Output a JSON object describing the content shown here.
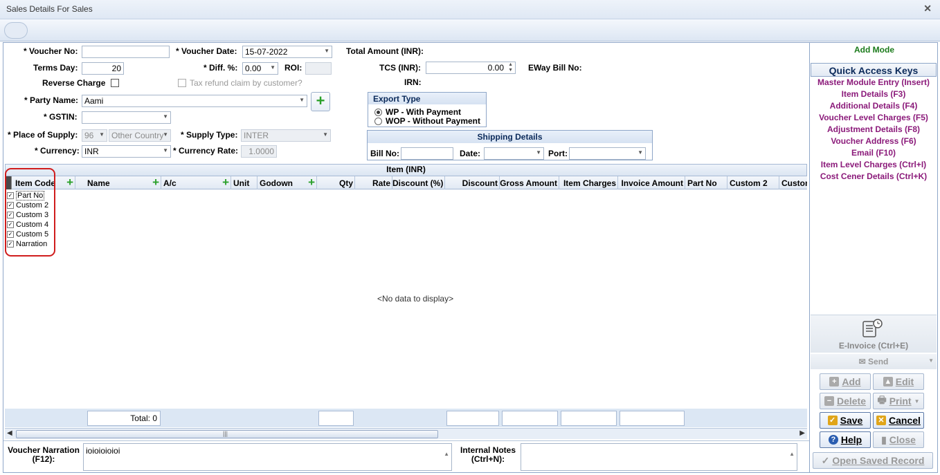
{
  "window": {
    "title": "Sales Details For Sales"
  },
  "form": {
    "voucher_no_label": "* Voucher No:",
    "voucher_no_value": "",
    "voucher_date_label": "* Voucher Date:",
    "voucher_date_value": "15-07-2022",
    "total_amount_label": "Total Amount (INR):",
    "terms_day_label": "Terms Day:",
    "terms_day_value": "20",
    "diff_label": "* Diff. %:",
    "diff_value": "0.00",
    "roi_label": "ROI:",
    "tcs_label": "TCS (INR):",
    "tcs_value": "0.00",
    "eway_label": "EWay Bill No:",
    "reverse_charge_label": "Reverse Charge",
    "tax_refund_label": "Tax refund claim by customer?",
    "irn_label": "IRN:",
    "party_name_label": "* Party Name:",
    "party_name_value": "Aami",
    "gstin_label": "* GSTIN:",
    "gstin_value": "",
    "place_label": "* Place of Supply:",
    "place_code": "96",
    "place_name": "Other Country",
    "supply_type_label": "* Supply Type:",
    "supply_type_value": "INTER",
    "currency_label": "* Currency:",
    "currency_value": "INR",
    "currency_rate_label": "* Currency Rate:",
    "currency_rate_value": "1.0000"
  },
  "export_type": {
    "title": "Export Type",
    "options": [
      {
        "label": "WP - With Payment",
        "selected": true
      },
      {
        "label": "WOP - Without Payment",
        "selected": false
      }
    ]
  },
  "shipping": {
    "title": "Shipping Details",
    "bill_no_label": "Bill No:",
    "date_label": "Date:",
    "port_label": "Port:"
  },
  "grid": {
    "band_title": "Item (INR)",
    "columns": [
      "Item Code",
      "Name",
      "A/c",
      "Unit",
      "Godown",
      "Qty",
      "Rate",
      "Discount (%)",
      "Discount",
      "Gross Amount",
      "Item Charges",
      "Invoice Amount",
      "Part No",
      "Custom 2",
      "Custom"
    ],
    "chooser_items": [
      "Part No",
      "Custom 2",
      "Custom 3",
      "Custom 4",
      "Custom 5",
      "Narration"
    ],
    "empty_text": "<No data to display>",
    "total_text": "Total: 0"
  },
  "bottom": {
    "narration_label_1": "Voucher Narration",
    "narration_label_2": "(F12):",
    "narration_value": "ioioioioioi",
    "notes_label_1": "Internal Notes",
    "notes_label_2": "(Ctrl+N):",
    "notes_value": ""
  },
  "sidebar": {
    "mode": "Add Mode",
    "quick_title": "Quick Access Keys",
    "keys": [
      "Master Module Entry (Insert)",
      "Item Details (F3)",
      "Additional Details (F4)",
      "Voucher Level Charges (F5)",
      "Adjustment Details (F8)",
      "Voucher Address (F6)",
      "Email (F10)",
      "Item Level Charges (Ctrl+I)",
      "Cost Cener Details (Ctrl+K)"
    ],
    "einvoice_label": "E-Invoice (Ctrl+E)",
    "send_label": "Send",
    "add_label": "Add",
    "edit_label": "Edit",
    "delete_label": "Delete",
    "print_label": "Print",
    "save_label": "Save",
    "cancel_label": "Cancel",
    "help_label": "Help",
    "close_label": "Close",
    "open_saved_label": "Open Saved Record"
  },
  "colors": {
    "accent": "#8b1a7a",
    "mode": "#1a7a1a",
    "highlight": "#d01c1c"
  }
}
